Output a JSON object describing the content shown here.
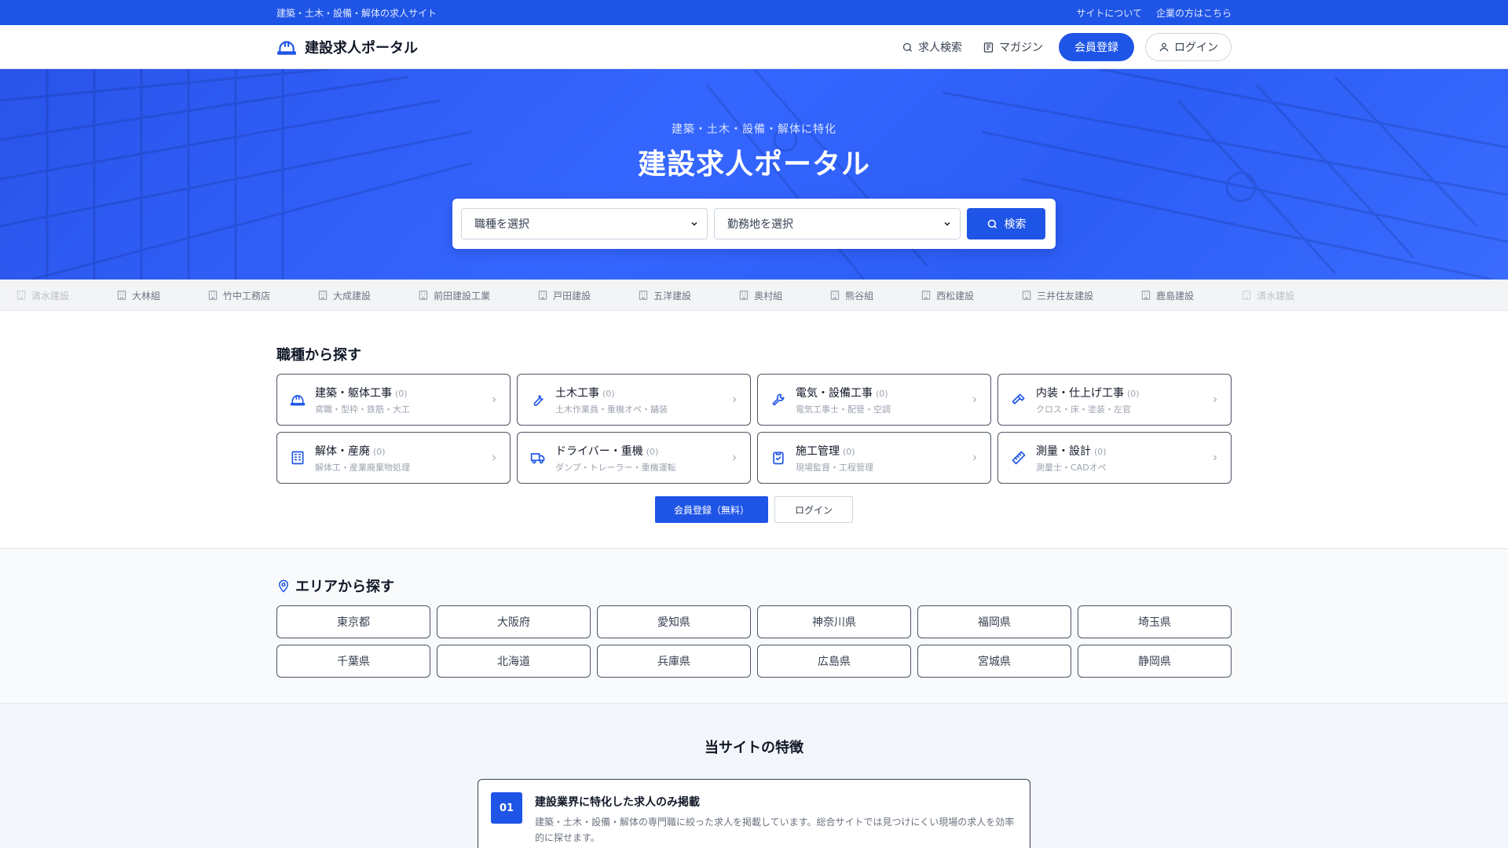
{
  "topbar": {
    "tagline": "建築・土木・設備・解体の求人サイト",
    "links": [
      "サイトについて",
      "企業の方はこちら"
    ]
  },
  "header": {
    "logo_text": "建設求人ポータル",
    "nav": {
      "search": "求人検索",
      "magazine": "マガジン",
      "register": "会員登録",
      "login": "ログイン"
    }
  },
  "hero": {
    "subtitle": "建築・土木・設備・解体に特化",
    "title": "建設求人ポータル",
    "job_select": "職種を選択",
    "area_select": "勤務地を選択",
    "search_button": "検索"
  },
  "companies": [
    "清水建設",
    "大林組",
    "竹中工務店",
    "大成建設",
    "前田建設工業",
    "戸田建設",
    "五洋建設",
    "奥村組",
    "熊谷組",
    "西松建設",
    "三井住友建設",
    "鹿島建設",
    "清水建設"
  ],
  "jobs": {
    "title": "職種から探す",
    "items": [
      {
        "name": "建築・躯体工事",
        "count": "(0)",
        "sub": "鳶職・型枠・鉄筋・大工",
        "icon": "hardhat-icon"
      },
      {
        "name": "土木工事",
        "count": "(0)",
        "sub": "土木作業員・重機オペ・舗装",
        "icon": "wrench-icon"
      },
      {
        "name": "電気・設備工事",
        "count": "(0)",
        "sub": "電気工事士・配管・空調",
        "icon": "tool-icon"
      },
      {
        "name": "内装・仕上げ工事",
        "count": "(0)",
        "sub": "クロス・床・塗装・左官",
        "icon": "hammer-icon"
      },
      {
        "name": "解体・産廃",
        "count": "(0)",
        "sub": "解体工・産業廃棄物処理",
        "icon": "building-icon"
      },
      {
        "name": "ドライバー・重機",
        "count": "(0)",
        "sub": "ダンプ・トレーラー・重機運転",
        "icon": "truck-icon"
      },
      {
        "name": "施工管理",
        "count": "(0)",
        "sub": "現場監督・工程管理",
        "icon": "clipboard-icon"
      },
      {
        "name": "測量・設計",
        "count": "(0)",
        "sub": "測量士・CADオペ",
        "icon": "ruler-icon"
      }
    ],
    "cta_register": "会員登録（無料）",
    "cta_login": "ログイン"
  },
  "area": {
    "title": "エリアから探す",
    "items": [
      "東京都",
      "大阪府",
      "愛知県",
      "神奈川県",
      "福岡県",
      "埼玉県",
      "千葉県",
      "北海道",
      "兵庫県",
      "広島県",
      "宮城県",
      "静岡県"
    ]
  },
  "features": {
    "title": "当サイトの特徴",
    "items": [
      {
        "num": "01",
        "heading": "建設業界に特化した求人のみ掲載",
        "desc": "建築・土木・設備・解体の専門職に絞った求人を掲載しています。総合サイトでは見つけにくい現場の求人を効率的に探せます。"
      }
    ]
  },
  "colors": {
    "accent": "#1f55e6",
    "topbar": "#1f55e6"
  }
}
